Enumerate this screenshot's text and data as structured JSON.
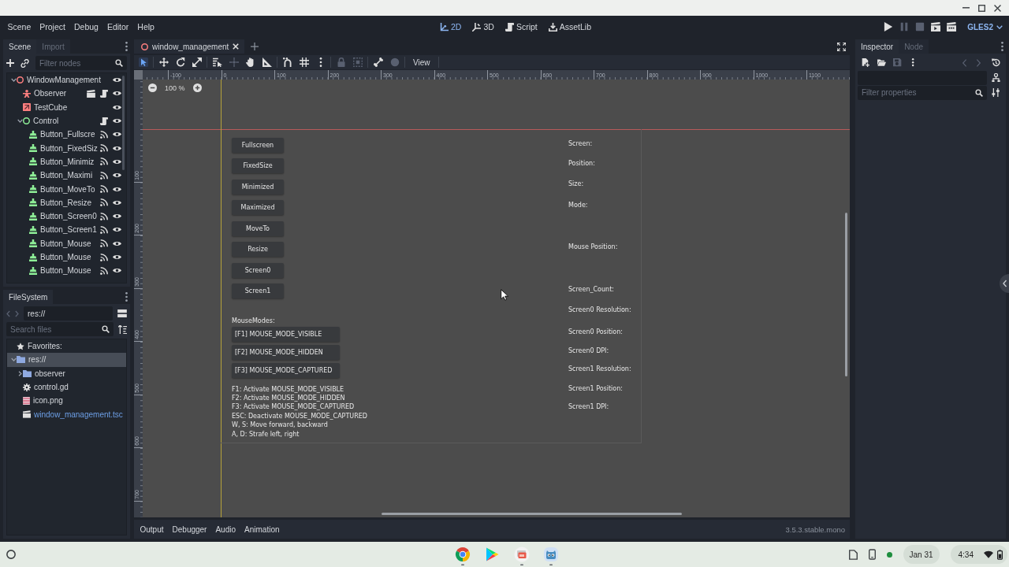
{
  "menu": [
    "Scene",
    "Project",
    "Debug",
    "Editor",
    "Help"
  ],
  "workspaces": [
    {
      "label": "2D",
      "kind": "canvas",
      "selected": true
    },
    {
      "label": "3D",
      "kind": "spatial",
      "selected": false
    },
    {
      "label": "Script",
      "kind": "script",
      "selected": false
    },
    {
      "label": "AssetLib",
      "kind": "assetlib",
      "selected": false
    }
  ],
  "run_buttons": [
    {
      "kind": "play",
      "disabled": false
    },
    {
      "kind": "pause",
      "disabled": true
    },
    {
      "kind": "stop",
      "disabled": true
    },
    {
      "kind": "play_scene",
      "disabled": false
    },
    {
      "kind": "play_custom",
      "disabled": false
    }
  ],
  "renderer": "GLES2",
  "scene_dock": {
    "tabs": [
      {
        "label": "Scene",
        "selected": true
      },
      {
        "label": "Import",
        "selected": false
      }
    ],
    "filter": {
      "placeholder": "Filter nodes"
    },
    "tree": [
      {
        "name": "WindowManagement",
        "kind": "spatial",
        "instanced": false,
        "script": false,
        "signals": false,
        "visible": true,
        "expanded": true,
        "children": [
          {
            "name": "Observer",
            "kind": "body",
            "instanced": true,
            "script": true,
            "signals": false,
            "visible": true
          },
          {
            "name": "TestCube",
            "kind": "mesh",
            "instanced": false,
            "script": false,
            "signals": false,
            "visible": true
          },
          {
            "name": "Control",
            "kind": "control",
            "instanced": false,
            "script": true,
            "signals": false,
            "visible": true,
            "expanded": true,
            "children": [
              {
                "name": "Button_Fullscre",
                "kind": "button",
                "instanced": false,
                "script": false,
                "signals": true,
                "visible": true
              },
              {
                "name": "Button_FixedSiz",
                "kind": "button",
                "instanced": false,
                "script": false,
                "signals": true,
                "visible": true
              },
              {
                "name": "Button_Minimiz",
                "kind": "button",
                "instanced": false,
                "script": false,
                "signals": true,
                "visible": true
              },
              {
                "name": "Button_Maximi",
                "kind": "button",
                "instanced": false,
                "script": false,
                "signals": true,
                "visible": true
              },
              {
                "name": "Button_MoveTo",
                "kind": "button",
                "instanced": false,
                "script": false,
                "signals": true,
                "visible": true
              },
              {
                "name": "Button_Resize",
                "kind": "button",
                "instanced": false,
                "script": false,
                "signals": true,
                "visible": true
              },
              {
                "name": "Button_Screen0",
                "kind": "button",
                "instanced": false,
                "script": false,
                "signals": true,
                "visible": true
              },
              {
                "name": "Button_Screen1",
                "kind": "button",
                "instanced": false,
                "script": false,
                "signals": true,
                "visible": true
              },
              {
                "name": "Button_Mouse",
                "kind": "button",
                "instanced": false,
                "script": false,
                "signals": true,
                "visible": true
              },
              {
                "name": "Button_Mouse",
                "kind": "button",
                "instanced": false,
                "script": false,
                "signals": true,
                "visible": true
              },
              {
                "name": "Button_Mouse",
                "kind": "button",
                "instanced": false,
                "script": false,
                "signals": true,
                "visible": true
              }
            ]
          }
        ]
      }
    ]
  },
  "filesystem": {
    "tabs": [
      {
        "label": "FileSystem",
        "selected": true
      }
    ],
    "path": "res://",
    "search": {
      "placeholder": "Search files"
    },
    "tree": [
      {
        "name": "Favorites:",
        "kind": "favorites",
        "selected": false,
        "current": false
      },
      {
        "name": "res://",
        "kind": "folder",
        "selected": true,
        "current": false,
        "expanded": true,
        "children": [
          {
            "name": "observer",
            "kind": "folder",
            "selected": false,
            "current": false,
            "expanded": false
          },
          {
            "name": "control.gd",
            "kind": "script",
            "selected": false,
            "current": false
          },
          {
            "name": "icon.png",
            "kind": "image",
            "selected": false,
            "current": false
          },
          {
            "name": "window_management.tsc",
            "kind": "scene",
            "selected": false,
            "current": true
          }
        ]
      }
    ]
  },
  "editor_tabs": [
    {
      "label": "window_management",
      "selected": true
    }
  ],
  "toolbar": {
    "tools": [
      [
        {
          "kind": "select",
          "selected": true,
          "disabled": false
        }
      ],
      [
        {
          "kind": "move",
          "selected": false,
          "disabled": false
        },
        {
          "kind": "rotate",
          "selected": false,
          "disabled": false
        },
        {
          "kind": "scale",
          "selected": false,
          "disabled": false
        }
      ],
      [
        {
          "kind": "list",
          "selected": false,
          "disabled": false
        },
        {
          "kind": "pivot",
          "selected": false,
          "disabled": true
        },
        {
          "kind": "pan",
          "selected": false,
          "disabled": false
        },
        {
          "kind": "ruler",
          "selected": false,
          "disabled": false
        }
      ],
      [
        {
          "kind": "snap",
          "selected": false,
          "disabled": false
        },
        {
          "kind": "grid",
          "selected": false,
          "disabled": false
        },
        {
          "kind": "more",
          "selected": false,
          "disabled": false
        }
      ],
      [
        {
          "kind": "lock",
          "selected": false,
          "disabled": true
        },
        {
          "kind": "group",
          "selected": false,
          "disabled": true
        }
      ],
      [
        {
          "kind": "bone",
          "selected": false,
          "disabled": false
        },
        {
          "kind": "light",
          "selected": false,
          "disabled": true
        }
      ]
    ],
    "view_menu": "View"
  },
  "viewport": {
    "zoom": "100 %",
    "top_ruler": [
      "-100",
      "0",
      "100",
      "200",
      "300",
      "400",
      "500",
      "600",
      "700",
      "800",
      "900",
      "1000",
      "1100"
    ],
    "left_ruler": [
      "100",
      "200",
      "300",
      "400",
      "500",
      "600",
      "700"
    ],
    "scene_ui": {
      "buttons": [
        "Fullscreen",
        "FixedSize",
        "Minimized",
        "Maximized",
        "MoveTo",
        "Resize",
        "Screen0",
        "Screen1"
      ],
      "mouse_modes_label": "MouseModes:",
      "mouse_mode_buttons": [
        "[F1] MOUSE_MODE_VISIBLE",
        "[F2] MOUSE_MODE_HIDDEN",
        "[F3] MOUSE_MODE_CAPTURED"
      ],
      "help_lines": [
        "F1: Activate MOUSE_MODE_VISIBLE",
        "F2: Activate MOUSE_MODE_HIDDEN",
        "F3: Activate MOUSE_MODE_CAPTURED",
        "ESC: Deactivate MOUSE_MODE_CAPTURED",
        "W, S: Move forward, backward",
        "A, D: Strafe left, right"
      ],
      "info_labels": [
        "Screen:",
        "Position:",
        "Size:",
        "Mode:",
        "Mouse Position:",
        "Screen_Count:",
        "Screen0 Resolution:",
        "Screen0 Position:",
        "Screen0 DPI:",
        "Screen1 Resolution:",
        "Screen1 Position:",
        "Screen1 DPI:"
      ]
    }
  },
  "bottom_panel": {
    "tabs": [
      "Output",
      "Debugger",
      "Audio",
      "Animation"
    ],
    "version": "3.5.3.stable.mono"
  },
  "inspector": {
    "tabs": [
      {
        "label": "Inspector",
        "selected": true
      },
      {
        "label": "Node",
        "selected": false
      }
    ],
    "tools": [
      {
        "kind": "new",
        "disabled": false
      },
      {
        "kind": "open",
        "disabled": false
      },
      {
        "kind": "save",
        "disabled": true
      },
      {
        "kind": "more",
        "disabled": false
      }
    ],
    "history": [
      {
        "kind": "back",
        "disabled": true
      },
      {
        "kind": "forward",
        "disabled": true
      }
    ],
    "filter": {
      "placeholder": "Filter properties"
    }
  },
  "taskbar": {
    "apps": [
      {
        "kind": "ring",
        "running": true
      },
      {
        "kind": "triangle",
        "running": false
      },
      {
        "kind": "gallery",
        "running": true
      },
      {
        "kind": "robot",
        "running": true
      }
    ],
    "date": "Jan 31",
    "time": "4:34"
  }
}
